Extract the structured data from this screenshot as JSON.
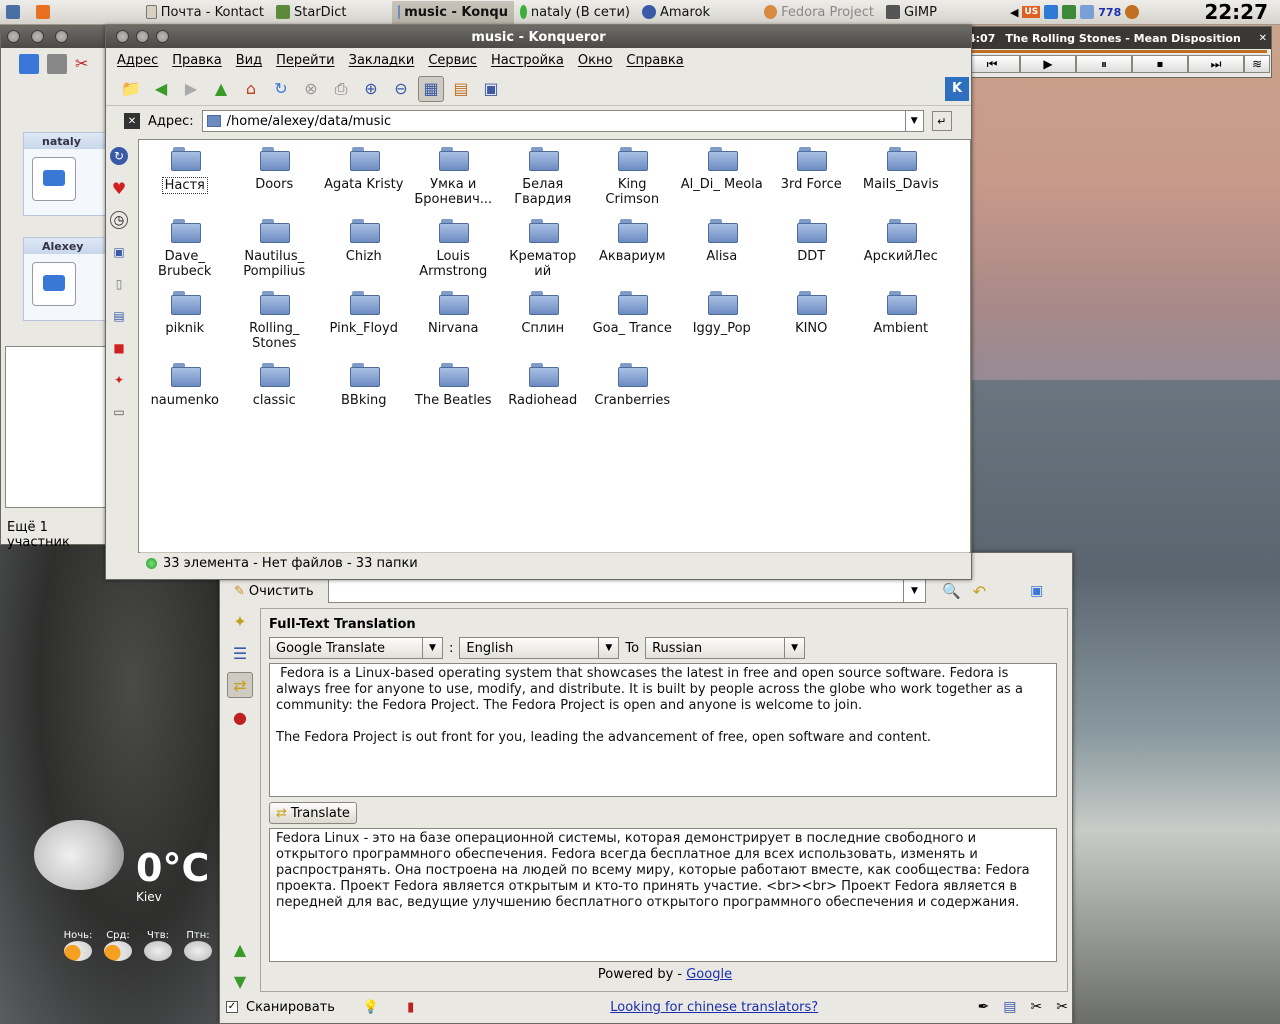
{
  "taskbar": {
    "tasks": [
      {
        "label": "Почта - Kontact"
      },
      {
        "label": "StarDict"
      },
      {
        "label": "music - Konqu"
      },
      {
        "label": "nataly (В сети)"
      },
      {
        "label": "Amarok"
      },
      {
        "label": "Fedora Project"
      },
      {
        "label": "GIMP"
      }
    ],
    "tray_counter": "778",
    "tray_lang": "US",
    "clock": "22:27"
  },
  "amarok": {
    "time": "4:07",
    "track": "The Rolling Stones - Mean Disposition"
  },
  "kopete": {
    "contacts": [
      {
        "name": "nataly"
      },
      {
        "name": "Alexey"
      }
    ],
    "footer": "Ещё 1 участник"
  },
  "konqueror": {
    "title": "music - Konqueror",
    "menu": [
      "Адрес",
      "Правка",
      "Вид",
      "Перейти",
      "Закладки",
      "Сервис",
      "Настройка",
      "Окно",
      "Справка"
    ],
    "address_label": "Адрес:",
    "address": "/home/alexey/data/music",
    "folders": [
      "Настя",
      "Doors",
      "Agata Kristy",
      "Умка и Броневич...",
      "Белая Гвардия",
      "King Crimson",
      "Al_Di_ Meola",
      "3rd Force",
      "Mails_Davis",
      "Dave_ Brubeck",
      "Nautilus_ Pompilius",
      "Chizh",
      "Louis Armstrong",
      "Крематор ий",
      "Аквариум",
      "Alisa",
      "DDT",
      "АрскийЛес",
      "piknik",
      "Rolling_ Stones",
      "Pink_Floyd",
      "Nirvana",
      "Сплин",
      "Goa_ Trance",
      "Iggy_Pop",
      "KINO",
      "Ambient",
      "naumenko",
      "classic",
      "BBking",
      "The Beatles",
      "Radiohead",
      "Cranberries"
    ],
    "status": "33 элемента - Нет файлов - 33 папки"
  },
  "stardict": {
    "clear_label": "Очистить",
    "section_title": "Full-Text Translation",
    "engine": "Google Translate",
    "from_lang": "English",
    "to_label": "To",
    "to_lang": "Russian",
    "source_text": " Fedora is a Linux-based operating system that showcases the latest in free and open source software. Fedora is always free for anyone to use, modify, and distribute. It is built by people across the globe who work together as a community: the Fedora Project. The Fedora Project is open and anyone is welcome to join.\n\nThe Fedora Project is out front for you, leading the advancement of free, open software and content.",
    "translate_label": "Translate",
    "result_text": "Fedora Linux - это на базе операционной системы, которая демонстрирует в последние свободного и открытого программного обеспечения. Fedora всегда бесплатное для всех использовать, изменять и распространять. Она построена на людей по всему миру, которые работают вместе, как сообщества: Fedora проекта. Проект Fedora является открытым и кто-то принять участие. <br><br> Проект Fedora является в передней для вас, ведущие улучшению бесплатного открытого программного обеспечения и содержания.",
    "powered_by": "Powered by - ",
    "powered_link": "Google",
    "scan_label": "Сканировать",
    "chinese_link": "Looking for chinese translators?"
  },
  "weather": {
    "temp": "0°C",
    "city": "Kiev",
    "days": [
      "Ночь:",
      "Срд:",
      "Чтв:",
      "Птн:"
    ]
  },
  "colors": {
    "title_bar": "#4b4a47",
    "folder_blue": "#6c8cc1",
    "link": "#1a2fb0"
  }
}
